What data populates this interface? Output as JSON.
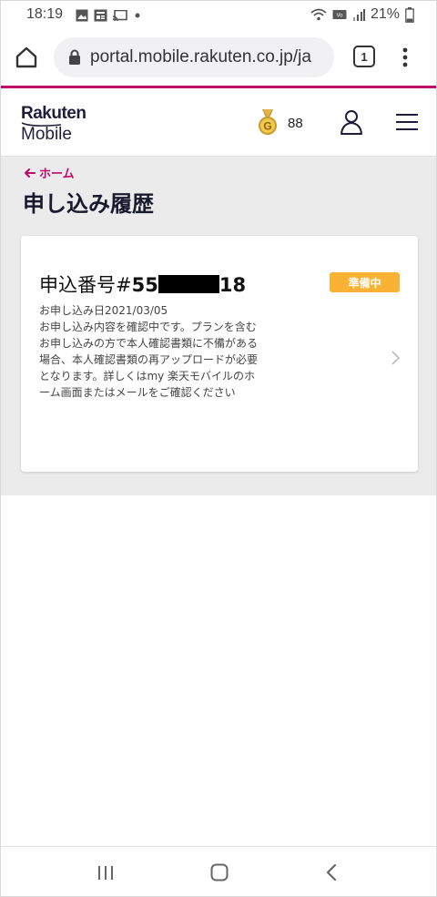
{
  "status_bar": {
    "time": "18:19",
    "battery": "21%",
    "notification_icons": [
      "gallery-icon",
      "news-icon",
      "cast-icon",
      "dot-icon"
    ],
    "status_icons": [
      "wifi-icon",
      "volte-icon",
      "signal-icon",
      "battery-icon"
    ]
  },
  "browser": {
    "url": "portal.mobile.rakuten.co.jp/ja",
    "tab_count": "1"
  },
  "header": {
    "logo_line1": "Rakuten",
    "logo_line2": "Mobile",
    "points": "88",
    "colors": {
      "accent": "#bf0a6a",
      "badge": "#f9b233",
      "text_dark": "#1a1a2e"
    }
  },
  "page": {
    "back_label": "ホーム",
    "title": "申し込み履歴"
  },
  "order": {
    "label_prefix": "申込番号#",
    "number_start": "55",
    "number_end": "18",
    "status": "準備中",
    "date": "お申し込み日2021/03/05",
    "message": "お申し込み内容を確認中です。プランを含むお申し込みの方で本人確認書類に不備がある場合、本人確認書類の再アップロードが必要となります。詳しくはmy 楽天モバイルのホーム画面またはメールをご確認ください"
  }
}
